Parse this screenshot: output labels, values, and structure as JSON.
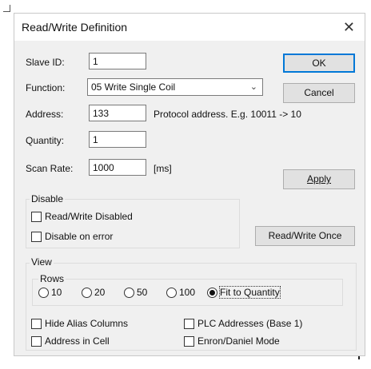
{
  "window": {
    "title": "Read/Write Definition",
    "close_symbol": "✕"
  },
  "slave_id": {
    "label": "Slave ID:",
    "value": "1"
  },
  "function": {
    "label": "Function:",
    "selected": "05 Write Single Coil"
  },
  "address": {
    "label": "Address:",
    "value": "133",
    "hint": "Protocol address. E.g. 10011 -> 10"
  },
  "quantity": {
    "label": "Quantity:",
    "value": "1"
  },
  "scan_rate": {
    "label": "Scan Rate:",
    "value": "1000",
    "unit": "[ms]"
  },
  "buttons": {
    "ok": "OK",
    "cancel": "Cancel",
    "apply": "Apply",
    "read_write_once": "Read/Write Once"
  },
  "disable_group": {
    "title": "Disable",
    "read_write_disabled": {
      "label": "Read/Write Disabled",
      "checked": false
    },
    "disable_on_error": {
      "label": "Disable on error",
      "checked": false
    }
  },
  "view_group": {
    "title": "View",
    "rows": {
      "title": "Rows",
      "options": [
        "10",
        "20",
        "50",
        "100",
        "Fit to Quantity"
      ],
      "selected": "Fit to Quantity"
    },
    "hide_alias_columns": {
      "label": "Hide Alias Columns",
      "checked": false
    },
    "plc_addresses": {
      "label": "PLC Addresses (Base 1)",
      "checked": false
    },
    "address_in_cell": {
      "label": "Address in Cell",
      "checked": false
    },
    "enron_daniel": {
      "label": "Enron/Daniel Mode",
      "checked": false
    }
  }
}
